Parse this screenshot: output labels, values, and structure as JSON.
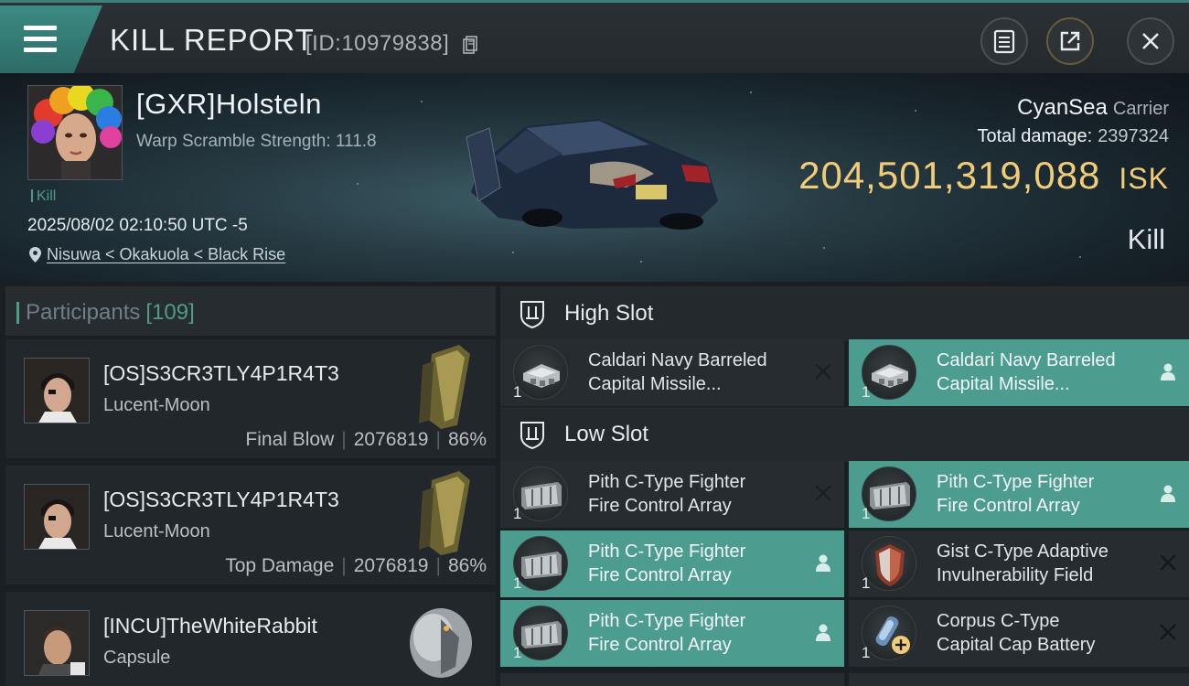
{
  "header": {
    "title": "KILL REPORT",
    "kill_id": "[ID:10979838]"
  },
  "victim": {
    "pilot": "[GXR]Holsteln",
    "warp_scramble": "Warp Scramble Strength: 111.8",
    "kill_tag": "Kill",
    "datetime": "2025/08/02 02:10:50 UTC -5",
    "location": "Nisuwa < Okakuola < Black Rise",
    "ship_name": "CyanSea",
    "ship_class": "Carrier",
    "total_damage_label": "Total damage:",
    "total_damage": "2397324",
    "isk_value": "204,501,319,088",
    "isk_unit": "ISK",
    "result": "Kill"
  },
  "participants": {
    "label": "Participants",
    "count": "[109]",
    "rows": [
      {
        "name": "[OS]S3CR3TLY4P1R4T3",
        "ship": "Lucent-Moon",
        "role": "Final Blow",
        "damage": "2076819",
        "percent": "86%"
      },
      {
        "name": "[OS]S3CR3TLY4P1R4T3",
        "ship": "Lucent-Moon",
        "role": "Top Damage",
        "damage": "2076819",
        "percent": "86%"
      },
      {
        "name": "[INCU]TheWhiteRabbit",
        "ship": "Capsule",
        "role": "",
        "damage": "",
        "percent": ""
      }
    ]
  },
  "slots": {
    "high": {
      "label": "High Slot",
      "modules": [
        {
          "line1": "Caldari Navy Barreled",
          "line2": "Capital Missile...",
          "qty": "1",
          "state": "destroyed"
        },
        {
          "line1": "Caldari Navy Barreled",
          "line2": "Capital Missile...",
          "qty": "1",
          "state": "dropped"
        }
      ]
    },
    "low": {
      "label": "Low Slot",
      "modules": [
        {
          "line1": "Pith C-Type Fighter",
          "line2": "Fire Control Array",
          "qty": "1",
          "state": "destroyed"
        },
        {
          "line1": "Pith C-Type Fighter",
          "line2": "Fire Control Array",
          "qty": "1",
          "state": "dropped"
        },
        {
          "line1": "Pith C-Type Fighter",
          "line2": "Fire Control Array",
          "qty": "1",
          "state": "dropped"
        },
        {
          "line1": "Gist C-Type Adaptive",
          "line2": "Invulnerability Field",
          "qty": "1",
          "state": "destroyed"
        },
        {
          "line1": "Pith C-Type Fighter",
          "line2": "Fire Control Array",
          "qty": "1",
          "state": "dropped"
        },
        {
          "line1": "Corpus C-Type",
          "line2": "Capital Cap Battery",
          "qty": "1",
          "state": "destroyed"
        }
      ]
    }
  },
  "colors": {
    "accent_teal": "#4c9d8f",
    "isk_gold": "#f0cc78"
  }
}
